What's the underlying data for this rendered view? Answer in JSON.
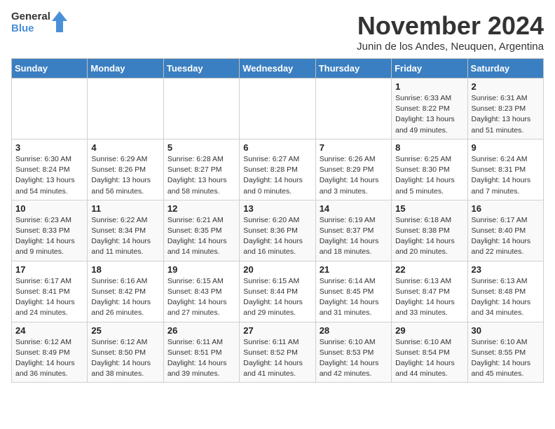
{
  "logo": {
    "general": "General",
    "blue": "Blue"
  },
  "title": "November 2024",
  "subtitle": "Junin de los Andes, Neuquen, Argentina",
  "days_of_week": [
    "Sunday",
    "Monday",
    "Tuesday",
    "Wednesday",
    "Thursday",
    "Friday",
    "Saturday"
  ],
  "weeks": [
    [
      {
        "day": "",
        "detail": ""
      },
      {
        "day": "",
        "detail": ""
      },
      {
        "day": "",
        "detail": ""
      },
      {
        "day": "",
        "detail": ""
      },
      {
        "day": "",
        "detail": ""
      },
      {
        "day": "1",
        "detail": "Sunrise: 6:33 AM\nSunset: 8:22 PM\nDaylight: 13 hours\nand 49 minutes."
      },
      {
        "day": "2",
        "detail": "Sunrise: 6:31 AM\nSunset: 8:23 PM\nDaylight: 13 hours\nand 51 minutes."
      }
    ],
    [
      {
        "day": "3",
        "detail": "Sunrise: 6:30 AM\nSunset: 8:24 PM\nDaylight: 13 hours\nand 54 minutes."
      },
      {
        "day": "4",
        "detail": "Sunrise: 6:29 AM\nSunset: 8:26 PM\nDaylight: 13 hours\nand 56 minutes."
      },
      {
        "day": "5",
        "detail": "Sunrise: 6:28 AM\nSunset: 8:27 PM\nDaylight: 13 hours\nand 58 minutes."
      },
      {
        "day": "6",
        "detail": "Sunrise: 6:27 AM\nSunset: 8:28 PM\nDaylight: 14 hours\nand 0 minutes."
      },
      {
        "day": "7",
        "detail": "Sunrise: 6:26 AM\nSunset: 8:29 PM\nDaylight: 14 hours\nand 3 minutes."
      },
      {
        "day": "8",
        "detail": "Sunrise: 6:25 AM\nSunset: 8:30 PM\nDaylight: 14 hours\nand 5 minutes."
      },
      {
        "day": "9",
        "detail": "Sunrise: 6:24 AM\nSunset: 8:31 PM\nDaylight: 14 hours\nand 7 minutes."
      }
    ],
    [
      {
        "day": "10",
        "detail": "Sunrise: 6:23 AM\nSunset: 8:33 PM\nDaylight: 14 hours\nand 9 minutes."
      },
      {
        "day": "11",
        "detail": "Sunrise: 6:22 AM\nSunset: 8:34 PM\nDaylight: 14 hours\nand 11 minutes."
      },
      {
        "day": "12",
        "detail": "Sunrise: 6:21 AM\nSunset: 8:35 PM\nDaylight: 14 hours\nand 14 minutes."
      },
      {
        "day": "13",
        "detail": "Sunrise: 6:20 AM\nSunset: 8:36 PM\nDaylight: 14 hours\nand 16 minutes."
      },
      {
        "day": "14",
        "detail": "Sunrise: 6:19 AM\nSunset: 8:37 PM\nDaylight: 14 hours\nand 18 minutes."
      },
      {
        "day": "15",
        "detail": "Sunrise: 6:18 AM\nSunset: 8:38 PM\nDaylight: 14 hours\nand 20 minutes."
      },
      {
        "day": "16",
        "detail": "Sunrise: 6:17 AM\nSunset: 8:40 PM\nDaylight: 14 hours\nand 22 minutes."
      }
    ],
    [
      {
        "day": "17",
        "detail": "Sunrise: 6:17 AM\nSunset: 8:41 PM\nDaylight: 14 hours\nand 24 minutes."
      },
      {
        "day": "18",
        "detail": "Sunrise: 6:16 AM\nSunset: 8:42 PM\nDaylight: 14 hours\nand 26 minutes."
      },
      {
        "day": "19",
        "detail": "Sunrise: 6:15 AM\nSunset: 8:43 PM\nDaylight: 14 hours\nand 27 minutes."
      },
      {
        "day": "20",
        "detail": "Sunrise: 6:15 AM\nSunset: 8:44 PM\nDaylight: 14 hours\nand 29 minutes."
      },
      {
        "day": "21",
        "detail": "Sunrise: 6:14 AM\nSunset: 8:45 PM\nDaylight: 14 hours\nand 31 minutes."
      },
      {
        "day": "22",
        "detail": "Sunrise: 6:13 AM\nSunset: 8:47 PM\nDaylight: 14 hours\nand 33 minutes."
      },
      {
        "day": "23",
        "detail": "Sunrise: 6:13 AM\nSunset: 8:48 PM\nDaylight: 14 hours\nand 34 minutes."
      }
    ],
    [
      {
        "day": "24",
        "detail": "Sunrise: 6:12 AM\nSunset: 8:49 PM\nDaylight: 14 hours\nand 36 minutes."
      },
      {
        "day": "25",
        "detail": "Sunrise: 6:12 AM\nSunset: 8:50 PM\nDaylight: 14 hours\nand 38 minutes."
      },
      {
        "day": "26",
        "detail": "Sunrise: 6:11 AM\nSunset: 8:51 PM\nDaylight: 14 hours\nand 39 minutes."
      },
      {
        "day": "27",
        "detail": "Sunrise: 6:11 AM\nSunset: 8:52 PM\nDaylight: 14 hours\nand 41 minutes."
      },
      {
        "day": "28",
        "detail": "Sunrise: 6:10 AM\nSunset: 8:53 PM\nDaylight: 14 hours\nand 42 minutes."
      },
      {
        "day": "29",
        "detail": "Sunrise: 6:10 AM\nSunset: 8:54 PM\nDaylight: 14 hours\nand 44 minutes."
      },
      {
        "day": "30",
        "detail": "Sunrise: 6:10 AM\nSunset: 8:55 PM\nDaylight: 14 hours\nand 45 minutes."
      }
    ]
  ]
}
